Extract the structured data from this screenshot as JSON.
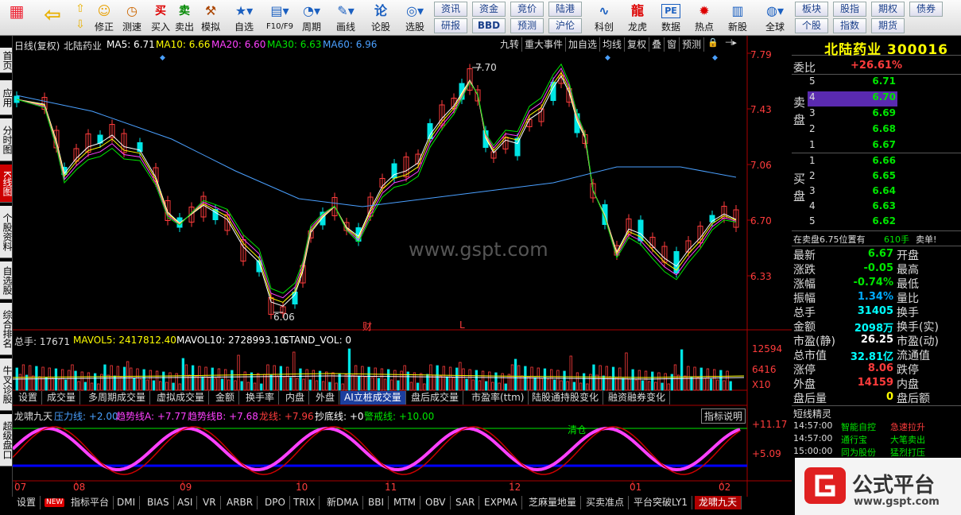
{
  "toolbar": {
    "big": [
      "修正",
      "测速",
      "买入",
      "卖出",
      "模拟",
      "自选",
      "F10/F9",
      "周期",
      "画线",
      "论股",
      "选股",
      "科创",
      "龙虎",
      "数据",
      "热点",
      "新股",
      "全球"
    ],
    "small_top": [
      "资讯",
      "资金",
      "竞价",
      "陆港",
      "板块",
      "股指",
      "期权",
      "债券"
    ],
    "small_bot": [
      "研报",
      "BBD",
      "预测",
      "沪伦",
      "个股",
      "指数",
      "期货"
    ],
    "buy_icon": "买",
    "sell_icon": "卖",
    "pe_icon": "PE"
  },
  "leftbar": [
    "首页",
    "应用",
    "分时图",
    "K线图",
    "个股资料",
    "自选股",
    "综合排名",
    "牛叉诊股",
    "超级盘口"
  ],
  "kline": {
    "header": {
      "title": "日线(复权)",
      "name": "北陆药业",
      "ma5": "MA5: 6.71",
      "ma10": "MA10: 6.66",
      "ma20": "MA20: 6.60",
      "ma30": "MA30: 6.63",
      "ma60": "MA60: 6.96"
    },
    "tools": [
      "九转",
      "重大事件",
      "加自选",
      "均线",
      "复权",
      "叠",
      "窗",
      "预测"
    ],
    "y_labels": [
      "7.79",
      "7.43",
      "7.06",
      "6.70",
      "6.33"
    ],
    "high_label": "7.70",
    "low_label": "6.06",
    "marks": [
      "财",
      "L"
    ],
    "watermark": "www.gspt.com"
  },
  "volume": {
    "label": "总手: 17671",
    "mavol5": "MAVOL5: 2417812.40",
    "mavol10": "MAVOL10: 2728993.10",
    "stand": "STAND_VOL: 0",
    "y_labels": [
      "12594",
      "6416",
      "X10"
    ]
  },
  "vol_tabs": [
    "设置",
    "成交量",
    "多周期成交量",
    "虚拟成交量",
    "金额",
    "换手率",
    "内盘",
    "外盘",
    "AI立桩成交量",
    "盘后成交量",
    "市盈率(ttm)",
    "陆股通持股变化",
    "融资融券变化"
  ],
  "indicator": {
    "name": "龙啸九天",
    "pressure": "压力线: +2.00",
    "trendA": "趋势线A: +7.77",
    "trendB": "趋势线B: +7.68",
    "dragon": "龙线: +7.96",
    "bottom": "抄底线: +0",
    "alert": "警戒线: +10.00",
    "btn": "指标说明",
    "clear": "清仓",
    "y_labels": [
      "+11.17",
      "+5.09"
    ]
  },
  "x_labels": [
    "07",
    "08",
    "09",
    "10",
    "11",
    "12",
    "01",
    "02"
  ],
  "bottom_tabs": [
    "设置",
    "指标平台",
    "DMI",
    "BIAS",
    "ASI",
    "VR",
    "ARBR",
    "DPO",
    "TRIX",
    "新DMA",
    "BBI",
    "MTM",
    "OBV",
    "SAR",
    "EXPMA",
    "芝麻量地量",
    "买卖准点",
    "平台突破LY1",
    "龙啸九天"
  ],
  "new_badge": "NEW",
  "quote": {
    "title": "北陆药业 300016",
    "weibi_label": "委比",
    "weibi": "+26.61%",
    "sell_label": "卖盘",
    "buy_label": "买盘",
    "sells": [
      {
        "lvl": "5",
        "p": "6.71"
      },
      {
        "lvl": "4",
        "p": "6.70"
      },
      {
        "lvl": "3",
        "p": "6.69"
      },
      {
        "lvl": "2",
        "p": "6.68"
      },
      {
        "lvl": "1",
        "p": "6.67"
      }
    ],
    "buys": [
      {
        "lvl": "1",
        "p": "6.66"
      },
      {
        "lvl": "2",
        "p": "6.65"
      },
      {
        "lvl": "3",
        "p": "6.64"
      },
      {
        "lvl": "4",
        "p": "6.63"
      },
      {
        "lvl": "5",
        "p": "6.62"
      }
    ],
    "notice": "在卖盘6.75位置有",
    "notice_qty": "610手",
    "notice_tag": "卖单!",
    "stats": [
      {
        "k": "最新",
        "v": "6.67",
        "k2": "开盘"
      },
      {
        "k": "涨跌",
        "v": "-0.05",
        "k2": "最高"
      },
      {
        "k": "涨幅",
        "v": "-0.74%",
        "k2": "最低"
      },
      {
        "k": "振幅",
        "v": "1.34%",
        "k2": "量比"
      },
      {
        "k": "总手",
        "v": "31405",
        "k2": "换手"
      },
      {
        "k": "金额",
        "v": "2098万",
        "k2": "换手(实)"
      },
      {
        "k": "市盈(静)",
        "v": "26.25",
        "k2": "市盈(动)"
      },
      {
        "k": "总市值",
        "v": "32.81亿",
        "k2": "流通值"
      },
      {
        "k": "涨停",
        "v": "8.06",
        "k2": "跌停"
      },
      {
        "k": "外盘",
        "v": "14159",
        "k2": "内盘"
      },
      {
        "k": "盘后量",
        "v": "0",
        "k2": "盘后额"
      }
    ],
    "elf_title": "短线精灵",
    "elf": [
      {
        "t": "14:57:00",
        "n": "智能自控",
        "e": "急速拉升"
      },
      {
        "t": "14:57:00",
        "n": "通行宝",
        "e": "大笔卖出"
      },
      {
        "t": "15:00:00",
        "n": "同为股份",
        "e": "猛烈打压"
      }
    ]
  },
  "logo": {
    "name": "公式平台",
    "url": "www.gspt.com"
  }
}
